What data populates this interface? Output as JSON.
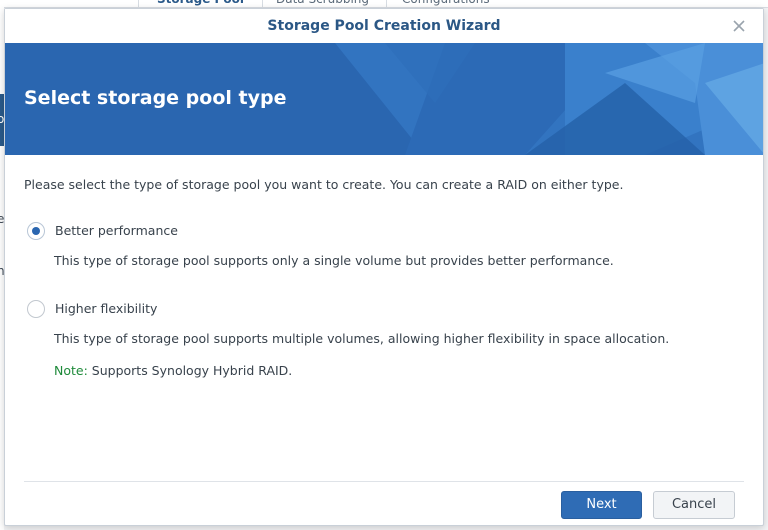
{
  "background": {
    "tabs": [
      {
        "label": "Storage Pool"
      },
      {
        "label": "Data Scrubbing"
      },
      {
        "label": "Configurations"
      }
    ],
    "left_fragments": [
      "o",
      "e",
      "n"
    ]
  },
  "dialog": {
    "title": "Storage Pool Creation Wizard",
    "close_icon": "close-icon",
    "banner_title": "Select storage pool type",
    "intro": "Please select the type of storage pool you want to create. You can create a RAID on either type.",
    "options": [
      {
        "label": "Better performance",
        "description": "This type of storage pool supports only a single volume but provides better performance.",
        "selected": true
      },
      {
        "label": "Higher flexibility",
        "description": "This type of storage pool supports multiple volumes, allowing higher flexibility in space allocation.",
        "selected": false
      }
    ],
    "note": {
      "key": "Note:",
      "text": " Supports Synology Hybrid RAID."
    },
    "buttons": {
      "next": "Next",
      "cancel": "Cancel"
    }
  },
  "colors": {
    "accent": "#2f6cb5",
    "title": "#2b5785",
    "note": "#1e8a3a"
  }
}
